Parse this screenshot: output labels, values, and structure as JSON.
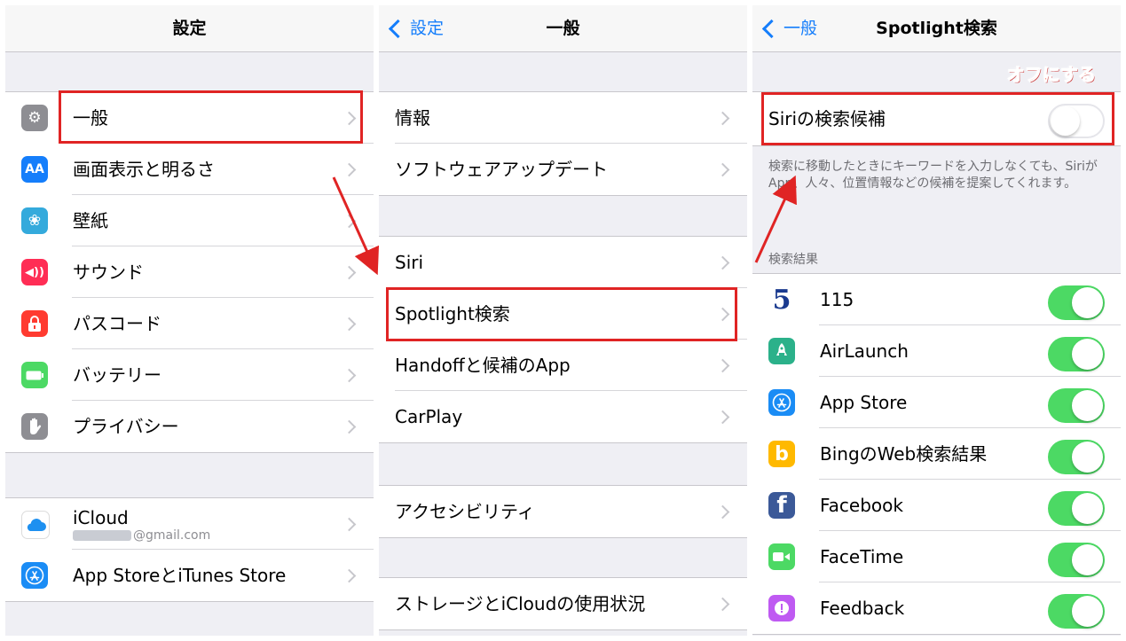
{
  "colors": {
    "accent": "#157efb",
    "toggle_on": "#4cd964",
    "annotation_red": "#e02424"
  },
  "panel1": {
    "title": "設定",
    "group1": [
      {
        "label": "一般",
        "icon": "gear-icon",
        "icon_color": "#8e8e93",
        "glyph": "⚙"
      },
      {
        "label": "画面表示と明るさ",
        "icon": "display-brightness-icon",
        "icon_color": "#157efb",
        "glyph": "AA"
      },
      {
        "label": "壁紙",
        "icon": "wallpaper-flower-icon",
        "icon_color": "#34aadc",
        "glyph": "❀"
      },
      {
        "label": "サウンド",
        "icon": "speaker-icon",
        "icon_color": "#ff2d55",
        "glyph": "◀)"
      },
      {
        "label": "パスコード",
        "icon": "lock-icon",
        "icon_color": "#ff3b30",
        "glyph": "🔒︎"
      },
      {
        "label": "バッテリー",
        "icon": "battery-icon",
        "icon_color": "#4cd964",
        "glyph": "▬"
      },
      {
        "label": "プライバシー",
        "icon": "hand-icon",
        "icon_color": "#8e8e93",
        "glyph": "✋︎"
      }
    ],
    "icloud": {
      "label": "iCloud",
      "email_suffix": "@gmail.com",
      "icon": "icloud-icon",
      "icon_color": "#ffffff"
    },
    "appstore": {
      "label": "App StoreとiTunes Store",
      "icon": "app-store-icon",
      "icon_color": "#1a8cf5"
    }
  },
  "panel2": {
    "back_label": "設定",
    "title": "一般",
    "group1": [
      "情報",
      "ソフトウェアアップデート"
    ],
    "group2": [
      "Siri",
      "Spotlight検索",
      "Handoffと候補のApp",
      "CarPlay"
    ],
    "group3": [
      "アクセシビリティ"
    ],
    "group4": [
      "ストレージとiCloudの使用状況"
    ]
  },
  "panel3": {
    "back_label": "一般",
    "title": "Spotlight検索",
    "annotation": "オフにする",
    "siri": {
      "label": "Siriの検索候補",
      "on": false
    },
    "siri_footer": "検索に移動したときにキーワードを入力しなくても、SiriがApp、人々、位置情報などの候補を提案してくれます。",
    "results_header": "検索結果",
    "results": [
      {
        "label": "115",
        "icon": "115-app-icon",
        "icon_color": "#ffffff",
        "glyph": "5",
        "on": true
      },
      {
        "label": "AirLaunch",
        "icon": "rocket-icon",
        "icon_color": "#2bb18a",
        "glyph": "🚀︎",
        "on": true
      },
      {
        "label": "App Store",
        "icon": "app-store-icon",
        "icon_color": "#1a8cf5",
        "glyph": "A",
        "on": true
      },
      {
        "label": "BingのWeb検索結果",
        "icon": "bing-icon",
        "icon_color": "#ffb900",
        "glyph": "b",
        "on": true
      },
      {
        "label": "Facebook",
        "icon": "facebook-icon",
        "icon_color": "#3b5998",
        "glyph": "f",
        "on": true
      },
      {
        "label": "FaceTime",
        "icon": "video-camera-icon",
        "icon_color": "#4cd964",
        "glyph": "■◀",
        "on": true
      },
      {
        "label": "Feedback",
        "icon": "feedback-icon",
        "icon_color": "#bf5af2",
        "glyph": "!",
        "on": true
      }
    ]
  }
}
